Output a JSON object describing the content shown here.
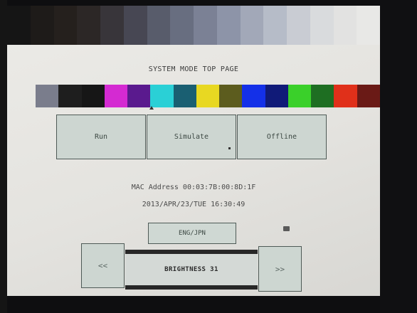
{
  "screen": {
    "title": "SYSTEM MODE TOP PAGE",
    "gray_ramp": [
      "#151515",
      "#1e1b19",
      "#25201d",
      "#2c2726",
      "#38353a",
      "#474753",
      "#585c6b",
      "#686e80",
      "#7b8195",
      "#8d94a8",
      "#a2a8b8",
      "#b6bcc8",
      "#c9ccd3",
      "#d9dbdd",
      "#e2e2e1",
      "#e8e8e6"
    ],
    "color_swatches": [
      "#7a7d8c",
      "#1e1e1e",
      "#161616",
      "#d42ad2",
      "#5a1a8e",
      "#2ad0d6",
      "#1a5f72",
      "#e8d822",
      "#5c5c1e",
      "#1430e8",
      "#101a78",
      "#3ad02a",
      "#1e6e22",
      "#e0301a",
      "#6a1a16"
    ],
    "buttons": {
      "run": "Run",
      "simulate": "Simulate",
      "offline": "Offline"
    },
    "mac_address": "MAC Address  00:03:7B:00:8D:1F",
    "datetime": "2013/APR/23/TUE  16:30:49",
    "lang_button": "ENG/JPN",
    "prev_button": "<<",
    "next_button": ">>",
    "brightness_label": "BRIGHTNESS 31"
  }
}
